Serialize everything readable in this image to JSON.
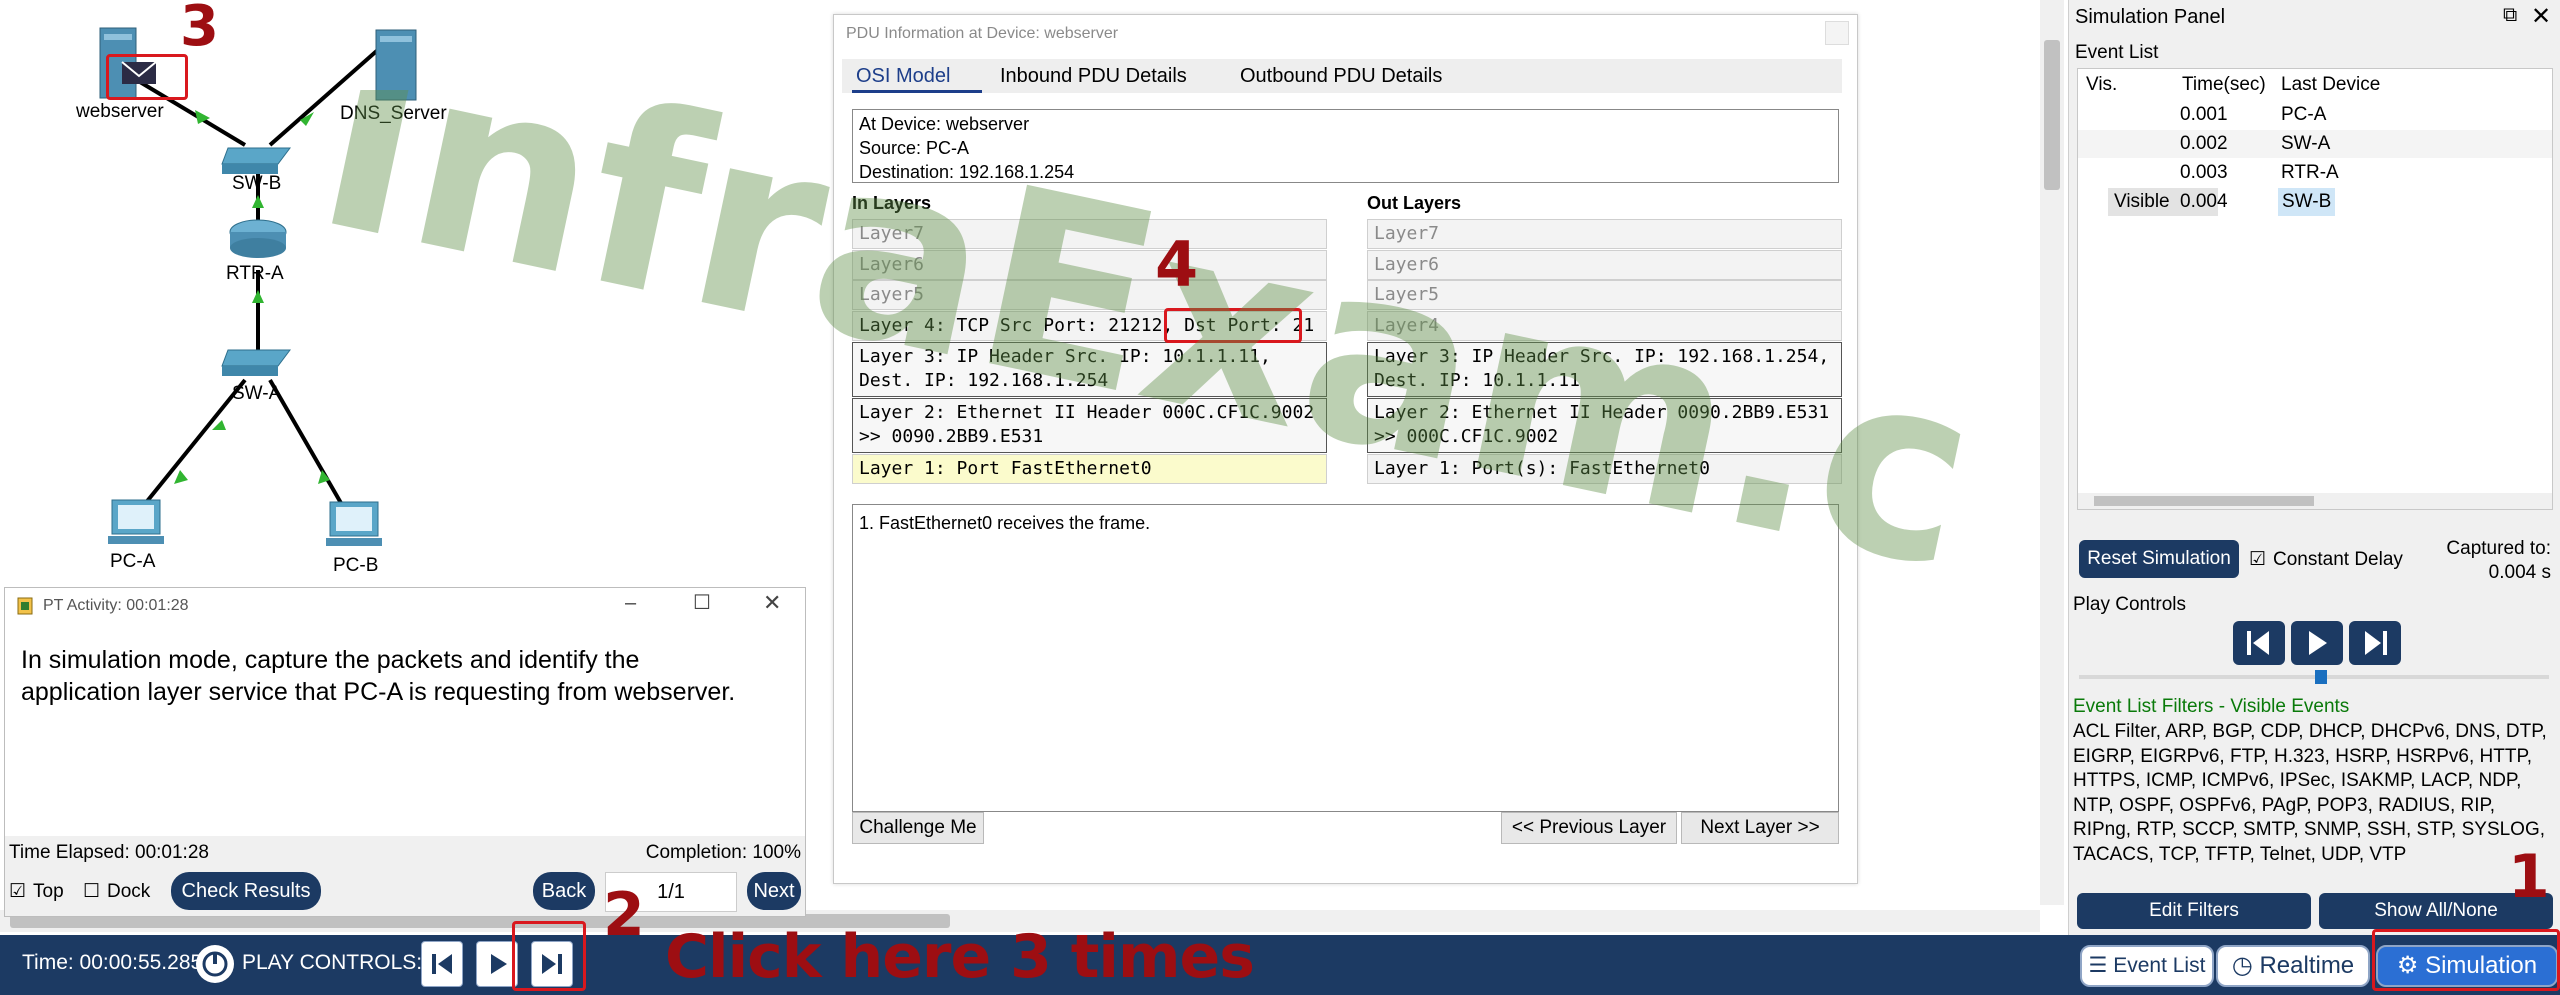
{
  "topology": {
    "devices": {
      "webserver": "webserver",
      "dns_server": "DNS_Server",
      "sw_b": "SW-B",
      "rtr_a": "RTR-A",
      "sw_a": "SW-A",
      "pc_a": "PC-A",
      "pc_b": "PC-B"
    }
  },
  "watermark": "InfraExam.com",
  "annotations": {
    "step1": "1",
    "step2": "2",
    "step3": "3",
    "step4": "4",
    "click_text": "Click here 3 times"
  },
  "pdu": {
    "title": "PDU Information at Device: webserver",
    "tabs": [
      "OSI Model",
      "Inbound PDU Details",
      "Outbound PDU Details"
    ],
    "info_lines": [
      "At Device: webserver",
      "Source: PC-A",
      "Destination: 192.168.1.254"
    ],
    "in_layers_title": "In Layers",
    "out_layers_title": "Out Layers",
    "in_layers": [
      "Layer7",
      "Layer6",
      "Layer5",
      "Layer 4: TCP Src Port: 21212, Dst Port: 21",
      "Layer 3: IP Header Src. IP: 10.1.1.11, Dest. IP: 192.168.1.254",
      "Layer 2: Ethernet II Header 000C.CF1C.9002 >> 0090.2BB9.E531",
      "Layer 1: Port FastEthernet0"
    ],
    "out_layers": [
      "Layer7",
      "Layer6",
      "Layer5",
      "Layer4",
      "Layer 3: IP Header Src. IP: 192.168.1.254, Dest. IP: 10.1.1.11",
      "Layer 2: Ethernet II Header 0090.2BB9.E531 >> 000C.CF1C.9002",
      "Layer 1: Port(s): FastEthernet0"
    ],
    "explanation": "1. FastEthernet0 receives the frame.",
    "challenge_label": "Challenge Me",
    "prev_label": "<< Previous Layer",
    "next_label": "Next Layer >>"
  },
  "activity": {
    "title": "PT Activity: 00:01:28",
    "instructions": "In simulation mode, capture the packets and identify the application layer service that PC-A is requesting from webserver.",
    "time_elapsed": "Time Elapsed: 00:01:28",
    "completion": "Completion: 100%",
    "top_label": "Top",
    "dock_label": "Dock",
    "check_results": "Check Results",
    "back": "Back",
    "page": "1/1",
    "next": "Next"
  },
  "sim_panel": {
    "title": "Simulation Panel",
    "event_list_title": "Event List",
    "columns": [
      "Vis.",
      "Time(sec)",
      "Last Device"
    ],
    "events": [
      {
        "vis": "",
        "time": "0.001",
        "device": "PC-A"
      },
      {
        "vis": "",
        "time": "0.002",
        "device": "SW-A"
      },
      {
        "vis": "",
        "time": "0.003",
        "device": "RTR-A"
      },
      {
        "vis": "Visible",
        "time": "0.004",
        "device": "SW-B"
      }
    ],
    "reset": "Reset Simulation",
    "constant_delay": "Constant Delay",
    "captured_label": "Captured to:",
    "captured_value": "0.004 s",
    "play_controls": "Play Controls",
    "filters_title": "Event List Filters - Visible Events",
    "filters_text": "ACL Filter, ARP, BGP, CDP, DHCP, DHCPv6, DNS, DTP, EIGRP, EIGRPv6, FTP, H.323, HSRP, HSRPv6, HTTP, HTTPS, ICMP, ICMPv6, IPSec, ISAKMP, LACP, NDP, NTP, OSPF, OSPFv6, PAgP, POP3, RADIUS, RIP, RIPng, RTP, SCCP, SMTP, SNMP, SSH, STP, SYSLOG, TACACS, TCP, TFTP, Telnet, UDP, VTP",
    "edit_filters": "Edit Filters",
    "show_all": "Show All/None"
  },
  "bottom": {
    "time": "Time: 00:00:55.285",
    "play_controls": "PLAY CONTROLS:",
    "event_list": "Event List",
    "realtime": "Realtime",
    "simulation": "Simulation"
  },
  "colors": {
    "navy": "#1c3a63",
    "annotation_red": "#9d0e12",
    "watermark_green": "#5f8f47",
    "link_green": "#0a8a0a"
  }
}
